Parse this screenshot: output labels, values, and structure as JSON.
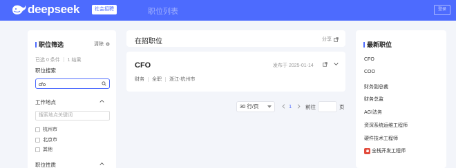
{
  "header": {
    "logo_text": "deepseek",
    "campus_tag": "社会招聘",
    "nav_title": "职位列表",
    "login_label": "登录"
  },
  "filter": {
    "title": "职位筛选",
    "clear_label": "清除",
    "selected_info": "已选 0 条件 ｜ 1 结果",
    "search_label": "职位搜索",
    "search_value": "cfo",
    "location_title": "工作地点",
    "location_placeholder": "搜索地点关键词",
    "locations": [
      "杭州市",
      "北京市",
      "其他"
    ],
    "nature_title": "职位性质"
  },
  "listing": {
    "title": "在招职位",
    "share_label": "分享"
  },
  "job": {
    "title": "CFO",
    "date": "发布于 2025-01-14",
    "category": "财务",
    "type": "全职",
    "location": "浙江-杭州市"
  },
  "pagination": {
    "page_size": "30 行/页",
    "current_page": "1",
    "goto_label": "前往",
    "page_unit": "页"
  },
  "latest": {
    "title": "最新职位",
    "items": [
      "CFO",
      "COO",
      "财务副总裁",
      "财务总监",
      "AGI法务",
      "资深系统运维工程师",
      "硬件技术工程师",
      "全栈开发工程师"
    ]
  },
  "colors": {
    "brand": "#4d6bfe",
    "hot_badge": "#e24a3b"
  }
}
